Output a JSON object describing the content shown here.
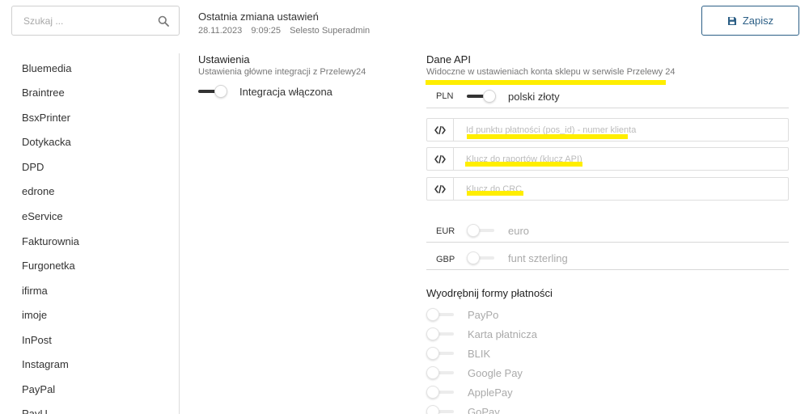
{
  "search": {
    "placeholder": "Szukaj ..."
  },
  "last_change": {
    "title": "Ostatnia zmiana ustawień",
    "date": "28.11.2023",
    "time": "9:09:25",
    "user": "Selesto Superadmin"
  },
  "toolbar": {
    "save_label": "Zapisz"
  },
  "sidebar": {
    "items": [
      "Bluemedia",
      "Braintree",
      "BsxPrinter",
      "Dotykacka",
      "DPD",
      "edrone",
      "eService",
      "Fakturownia",
      "Furgonetka",
      "ifirma",
      "imoje",
      "InPost",
      "Instagram",
      "PayPal",
      "PayU"
    ]
  },
  "settings": {
    "title": "Ustawienia",
    "subtitle": "Ustawienia główne integracji z Przelewy24",
    "integration_toggle": {
      "label": "Integracja włączona",
      "on": true
    }
  },
  "api": {
    "title": "Dane API",
    "subtitle": "Widoczne w ustawieniach konta sklepu w serwisle Przelewy 24",
    "currencies": [
      {
        "code": "PLN",
        "name": "polski złoty",
        "on": true
      },
      {
        "code": "EUR",
        "name": "euro",
        "on": false
      },
      {
        "code": "GBP",
        "name": "funt szterling",
        "on": false
      }
    ],
    "fields": [
      {
        "placeholder": "Id punktu płatności (pos_id) - numer klienta",
        "value": ""
      },
      {
        "placeholder": "Klucz do raportów (klucz API)",
        "value": ""
      },
      {
        "placeholder": "Klucz do CRC",
        "value": ""
      }
    ]
  },
  "payment_forms": {
    "title": "Wyodrębnij formy płatności",
    "items": [
      {
        "label": "PayPo",
        "on": false
      },
      {
        "label": "Karta płatnicza",
        "on": false
      },
      {
        "label": "BLIK",
        "on": false
      },
      {
        "label": "Google Pay",
        "on": false
      },
      {
        "label": "ApplePay",
        "on": false
      },
      {
        "label": "GoPay",
        "on": false
      }
    ]
  },
  "colors": {
    "accent": "#2c5f86",
    "highlight": "#ffee00"
  },
  "icons": {
    "search": "search-icon",
    "save": "floppy-disk-icon",
    "code": "code-icon"
  }
}
